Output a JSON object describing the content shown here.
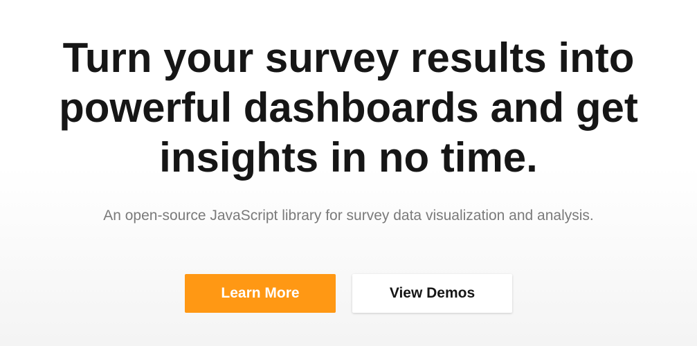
{
  "hero": {
    "title_lines": [
      "Turn your survey results into",
      "powerful dashboards and get",
      "insights in no time."
    ],
    "subtitle": "An open-source JavaScript library for survey data visualization and analysis."
  },
  "actions": {
    "primary_label": "Learn More",
    "secondary_label": "View Demos"
  },
  "colors": {
    "accent": "#ff9814",
    "heading": "#161616",
    "subtitle": "#7a7a7a",
    "background": "#ffffff"
  }
}
